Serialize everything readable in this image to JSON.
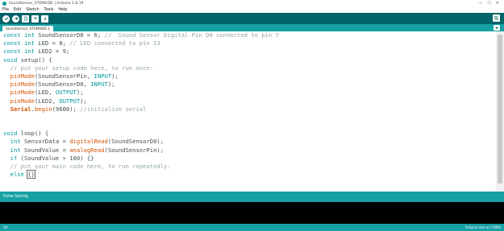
{
  "window": {
    "title": "SoundSensor_STEMAIDE | Arduino 1.8.19",
    "minimize_symbol": "—",
    "maximize_symbol": "☐",
    "close_symbol": "✕"
  },
  "menu": [
    "File",
    "Edit",
    "Sketch",
    "Tools",
    "Help"
  ],
  "toolbar": {
    "buttons": [
      "verify-icon",
      "upload-icon",
      "new-icon",
      "open-icon",
      "save-icon"
    ],
    "serial_monitor_icon": "magnifier-icon"
  },
  "tabs": {
    "active_label": "SoundSensor_STEMAIDE §",
    "menu_icon": "triangle-down-icon"
  },
  "code_lines": [
    "const int SoundSensorD0 = 6; //  Sound Sensor Digital Pin D0 connected to pin 7",
    "const int LED = 8; // LED connected to pin 13",
    "const int LED2 = 9;",
    "void setup() {",
    "  // put your setup code here, to run once:",
    "  pinMode(SoundSensorPin, INPUT);",
    "  pinMode(SoundSensorD0, INPUT);",
    "  pinMode(LED, OUTPUT);",
    "  pinMode(LED2, OUTPUT);",
    "  Serial.begin(9600); //initialize serial",
    "",
    "",
    "void loop() {",
    "  int SensorData = digitalRead(SoundSensorD0);",
    "  int SoundValue = analogRead(SoundSensorPin);",
    "  if (SoundValue > 100) {}",
    "  // put your main code here, to run repeatedly:",
    "  else {}"
  ],
  "status": {
    "message": "Done Saving."
  },
  "footer": {
    "line_number": "18",
    "board": "Arduino Uno on COM4"
  }
}
